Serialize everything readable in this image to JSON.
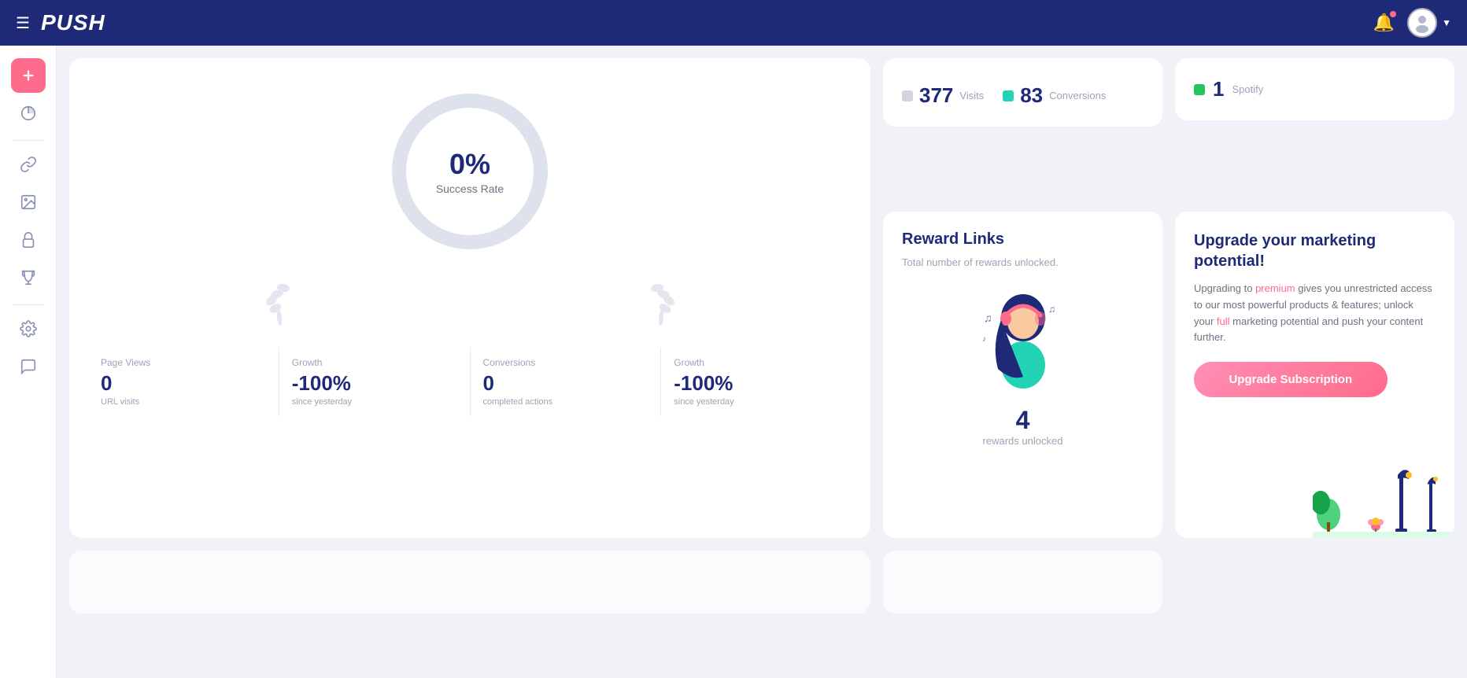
{
  "topnav": {
    "logo": "PUSH",
    "menu_icon": "☰"
  },
  "sidebar": {
    "items": [
      {
        "name": "add",
        "icon": "plus",
        "active": true
      },
      {
        "name": "analytics",
        "icon": "analytics",
        "active": false
      },
      {
        "name": "links",
        "icon": "link",
        "active": false
      },
      {
        "name": "media",
        "icon": "media",
        "active": false
      },
      {
        "name": "lock",
        "icon": "lock",
        "active": false
      },
      {
        "name": "trophy",
        "icon": "trophy",
        "active": false
      },
      {
        "name": "settings",
        "icon": "settings",
        "active": false
      },
      {
        "name": "chat",
        "icon": "chat",
        "active": false
      }
    ]
  },
  "success_rate": {
    "percent": "0%",
    "label": "Success Rate",
    "stats": [
      {
        "title": "Page Views",
        "value": "0",
        "sub": "URL visits"
      },
      {
        "title": "Growth",
        "value": "-100%",
        "sub": "since yesterday"
      },
      {
        "title": "Conversions",
        "value": "0",
        "sub": "completed actions"
      },
      {
        "title": "Growth",
        "value": "-100%",
        "sub": "since yesterday"
      }
    ]
  },
  "visits": {
    "visits_number": "377",
    "visits_label": "Visits",
    "conversions_number": "83",
    "conversions_label": "Conversions"
  },
  "spotify": {
    "number": "1",
    "label": "Spotify"
  },
  "reward_links": {
    "title": "Reward Links",
    "desc": "Total number of rewards unlocked.",
    "count": "4",
    "count_label": "rewards unlocked"
  },
  "upgrade": {
    "title": "Upgrade your marketing potential!",
    "desc_1": "Upgrading to ",
    "highlight_1": "premium",
    "desc_2": " gives you unrestricted access to our most powerful products & features; unlock your ",
    "highlight_2": "full",
    "desc_3": " marketing potential and push your content further.",
    "button_label": "Upgrade Subscription"
  }
}
